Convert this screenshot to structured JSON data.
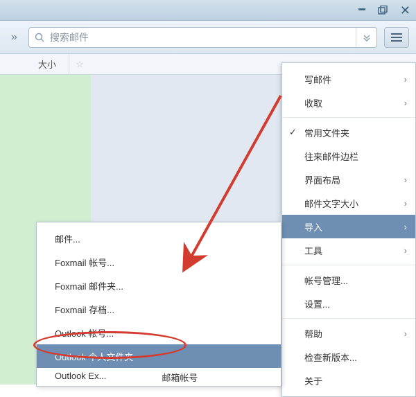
{
  "window": {
    "title": ""
  },
  "toolbar": {
    "search_placeholder": "搜索邮件"
  },
  "columns": {
    "size": "大小",
    "star": "★"
  },
  "menu": {
    "compose": "写邮件",
    "receive": "收取",
    "common_folders": "常用文件夹",
    "contacts_sidebar": "往来邮件边栏",
    "layout": "界面布局",
    "font_size": "邮件文字大小",
    "import": "导入",
    "tools": "工具",
    "account_mgmt": "帐号管理...",
    "settings": "设置...",
    "help": "帮助",
    "check_update": "检查新版本...",
    "about": "关于"
  },
  "submenu": {
    "mail": "邮件...",
    "foxmail_account": "Foxmail 帐号...",
    "foxmail_folder": "Foxmail 邮件夹...",
    "foxmail_archive": "Foxmail 存档...",
    "outlook_account": "Outlook 帐号...",
    "outlook_pst": "Outlook 个人文件夹",
    "outlook_more": "Outlook Ex...",
    "addrbook": "邮箱帐号"
  },
  "icons": {
    "chevron": "›",
    "check": "✓",
    "doublechev": "»",
    "chevdown": "▾"
  }
}
